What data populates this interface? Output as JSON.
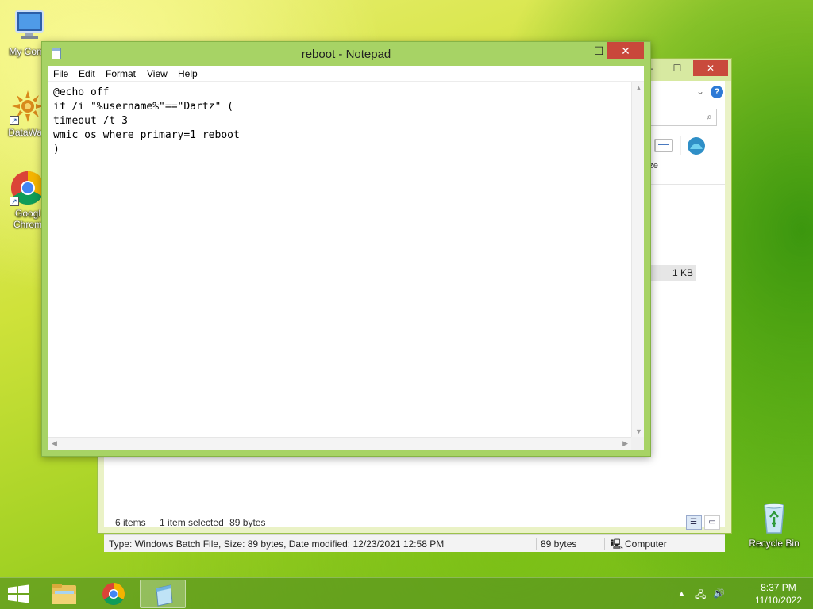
{
  "desktop": {
    "icons": [
      {
        "label": "My Comp"
      },
      {
        "label": "DataWag"
      },
      {
        "label": "Googl\nChrom"
      },
      {
        "label": "Recycle Bin"
      }
    ]
  },
  "explorer": {
    "size_cell": "1 KB",
    "ribbon_text": "ze",
    "status": {
      "items": "6 items",
      "selected": "1 item selected",
      "size": "89 bytes"
    },
    "details": {
      "info": "Type: Windows Batch File, Size: 89 bytes, Date modified: 12/23/2021 12:58 PM",
      "size": "89 bytes",
      "location": "Computer"
    }
  },
  "notepad": {
    "title": "reboot - Notepad",
    "menu": [
      "File",
      "Edit",
      "Format",
      "View",
      "Help"
    ],
    "lines": [
      "@echo off",
      "if /i \"%username%\"==\"Dartz\" (",
      "timeout /t 3",
      "wmic os where primary=1 reboot",
      ")"
    ]
  },
  "taskbar": {
    "clock_time": "8:37 PM",
    "clock_date": "11/10/2022"
  },
  "colors": {
    "accent": "#a7d365",
    "close": "#c9483b"
  }
}
